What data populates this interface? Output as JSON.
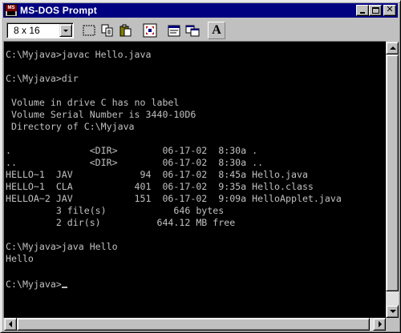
{
  "window": {
    "title": "MS-DOS Prompt",
    "app_icon_label": "MS",
    "controls": [
      "minimize-icon",
      "maximize-icon",
      "close-icon"
    ],
    "close_glyph": "✕"
  },
  "toolbar": {
    "font_size_value": "8 x 16",
    "buttons": [
      {
        "name": "mark-button",
        "icon": "mark-icon"
      },
      {
        "name": "copy-button",
        "icon": "copy-icon"
      },
      {
        "name": "paste-button",
        "icon": "paste-icon"
      },
      {
        "name": "full-screen-button",
        "icon": "full-screen-icon"
      },
      {
        "name": "properties-button",
        "icon": "properties-icon"
      },
      {
        "name": "background-button",
        "icon": "background-icon"
      },
      {
        "name": "font-button",
        "icon": "font-icon",
        "label": "A"
      }
    ]
  },
  "console": {
    "lines": [
      "C:\\Myjava>javac Hello.java",
      "",
      "C:\\Myjava>dir",
      "",
      " Volume in drive C has no label",
      " Volume Serial Number is 3440-10D6",
      " Directory of C:\\Myjava",
      "",
      ".              <DIR>        06-17-02  8:30a .",
      "..             <DIR>        06-17-02  8:30a ..",
      "HELLO~1  JAV            94  06-17-02  8:45a Hello.java",
      "HELLO~1  CLA           401  06-17-02  9:35a Hello.class",
      "HELLOA~2 JAV           151  06-17-02  9:09a HelloApplet.java",
      "         3 file(s)            646 bytes",
      "         2 dir(s)          644.12 MB free",
      "",
      "C:\\Myjava>java Hello",
      "Hello",
      ""
    ],
    "prompt": "C:\\Myjava>"
  },
  "colors": {
    "title_bar": "#000080",
    "console_bg": "#000000",
    "console_text": "#c0c0c0",
    "chrome": "#c0c0c0"
  }
}
